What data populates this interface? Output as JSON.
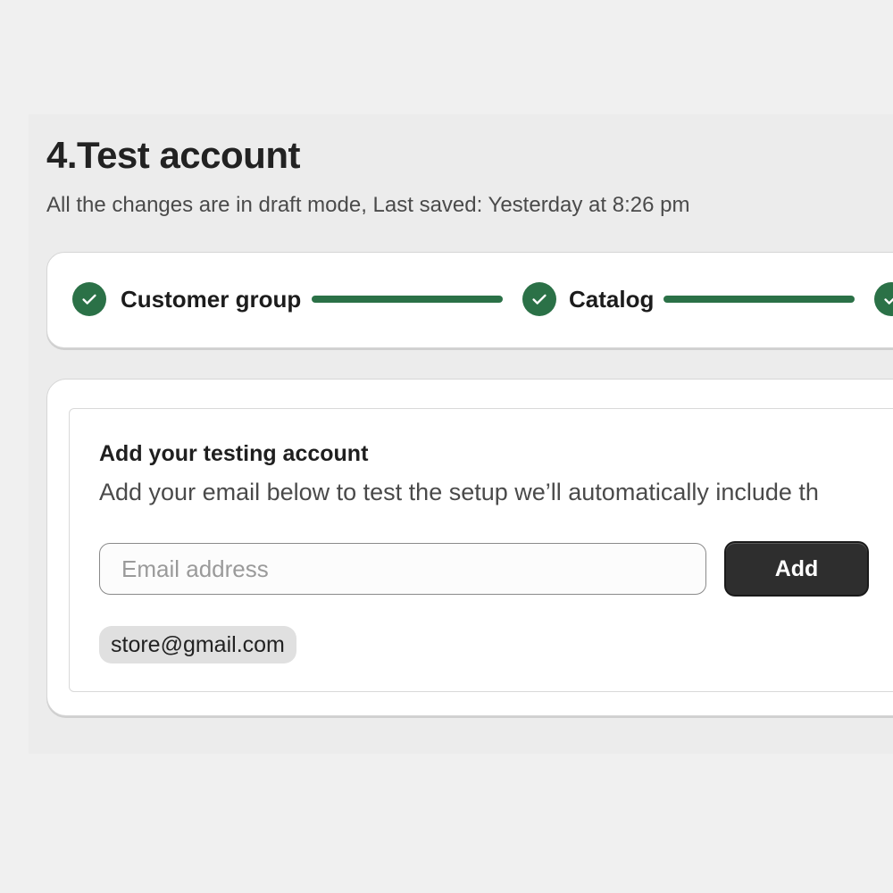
{
  "page": {
    "title": "4.Test account",
    "subtitle": "All the changes are in draft mode, Last saved: Yesterday at 8:26 pm"
  },
  "stepper": {
    "steps": [
      {
        "label": "Customer group",
        "status": "complete"
      },
      {
        "label": "Catalog",
        "status": "complete"
      },
      {
        "label": "",
        "status": "complete"
      }
    ],
    "accent_color": "#2b7147"
  },
  "testing_account": {
    "heading": "Add your testing account",
    "description": "Add your email below to test the setup we’ll automatically include th",
    "email_input": {
      "placeholder": "Email address",
      "value": ""
    },
    "add_button_label": "Add",
    "added_emails": [
      "store@gmail.com"
    ]
  }
}
